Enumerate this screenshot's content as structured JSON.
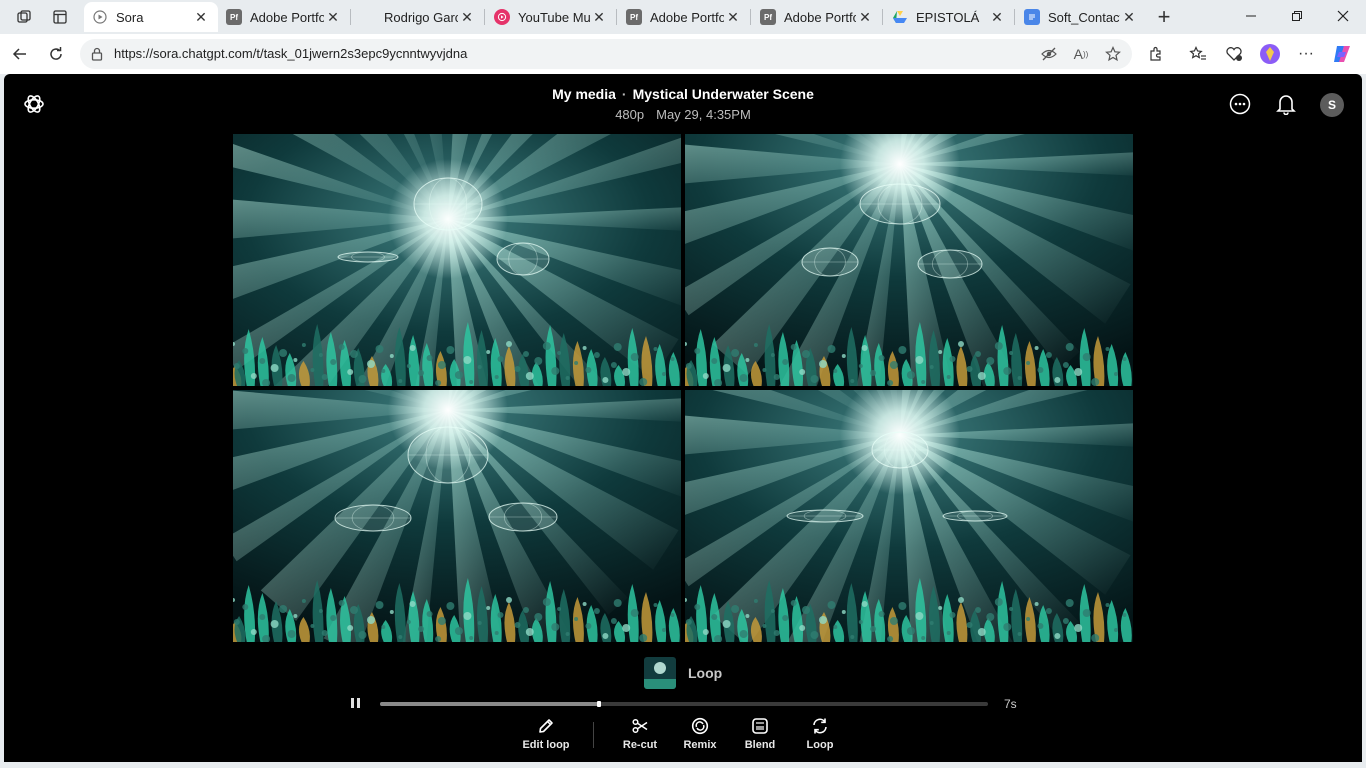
{
  "browser": {
    "tabs": [
      {
        "title": "Sora",
        "favicon": "sora-play-icon",
        "active": true
      },
      {
        "title": "Adobe Portfo",
        "favicon": "adobe-portfolio-icon",
        "active": false
      },
      {
        "title": "Rodrigo Garc",
        "favicon": "",
        "active": false
      },
      {
        "title": "YouTube Mus",
        "favicon": "youtube-music-icon",
        "active": false
      },
      {
        "title": "Adobe Portfo",
        "favicon": "adobe-portfolio-icon",
        "active": false
      },
      {
        "title": "Adobe Portfo",
        "favicon": "adobe-portfolio-icon",
        "active": false
      },
      {
        "title": "EPISTOLÁ",
        "favicon": "google-drive-icon",
        "active": false
      },
      {
        "title": "Soft_Contact_",
        "favicon": "google-docs-icon",
        "active": false
      }
    ],
    "url": "https://sora.chatgpt.com/t/task_01jwern2s3epc9ycnntwyvjdna"
  },
  "page": {
    "breadcrumb_parent": "My media",
    "separator": "·",
    "title": "Mystical Underwater Scene",
    "resolution": "480p",
    "timestamp": "May 29, 4:35PM",
    "avatar_letter": "S"
  },
  "player": {
    "mode_label": "Loop",
    "duration": "7s",
    "progress": 0.36
  },
  "actions": [
    {
      "label": "Edit loop",
      "icon": "pencil-icon"
    },
    {
      "label": "Re-cut",
      "icon": "scissors-icon"
    },
    {
      "label": "Remix",
      "icon": "remix-icon"
    },
    {
      "label": "Blend",
      "icon": "blend-icon"
    },
    {
      "label": "Loop",
      "icon": "loop-icon"
    }
  ],
  "colors": {
    "page_bg": "#000000",
    "water": "#0f3a3c",
    "coral": "#2ec4a0",
    "light": "#e8fff8"
  }
}
